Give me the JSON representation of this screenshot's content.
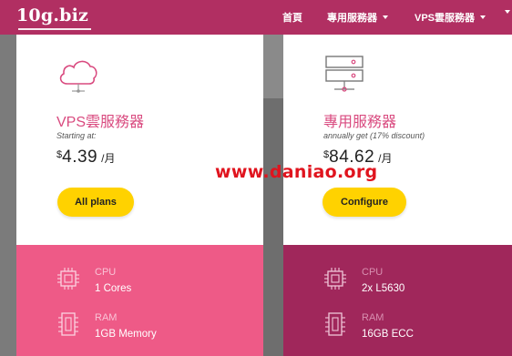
{
  "header": {
    "logo": "10g.biz",
    "nav": [
      {
        "label": "首頁"
      },
      {
        "label": "專用服務器"
      },
      {
        "label": "VPS雲服務器"
      }
    ]
  },
  "plans": [
    {
      "icon": "cloud-icon",
      "title": "VPS雲服務器",
      "subtitle": "Starting at:",
      "currency": "$",
      "price": "4.39",
      "period": "/月",
      "button": "All plans",
      "specs": [
        {
          "icon": "cpu-icon",
          "label": "CPU",
          "value": "1 Cores"
        },
        {
          "icon": "ram-icon",
          "label": "RAM",
          "value": "1GB Memory"
        }
      ]
    },
    {
      "icon": "server-rack-icon",
      "title": "專用服務器",
      "subtitle": "annually get (17% discount)",
      "currency": "$",
      "price": "84.62",
      "period": "/月",
      "button": "Configure",
      "specs": [
        {
          "icon": "cpu-icon",
          "label": "CPU",
          "value": "2x L5630"
        },
        {
          "icon": "ram-icon",
          "label": "RAM",
          "value": "16GB ECC"
        }
      ]
    }
  ],
  "watermark": "www.daniao.org",
  "colors": {
    "header": "#b12f62",
    "accent_pink": "#ee5a87",
    "accent_deep": "#a0275b",
    "button": "#ffd200",
    "watermark": "#e0141e"
  }
}
